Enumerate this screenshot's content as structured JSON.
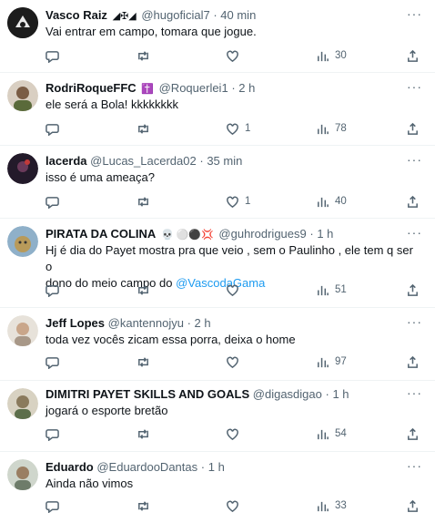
{
  "tweets": [
    {
      "name": "Vasco Raiz",
      "badges": "◢✠◢",
      "handle": "@hugoficial7",
      "time": "40 min",
      "lines": [
        "Vai entrar em campo, tomara que jogue."
      ],
      "likes": "",
      "views": "30",
      "avatar_color": "#1c1c1c"
    },
    {
      "name": "RodriRoqueFFC",
      "badges": "✝️",
      "handle": "@Roquerlei1",
      "time": "2 h",
      "lines": [
        "ele será a Bola! kkkkkkkk"
      ],
      "likes": "1",
      "views": "78",
      "avatar_color": "#7a5c44"
    },
    {
      "name": "lacerda",
      "badges": "",
      "handle": "@Lucas_Lacerda02",
      "time": "35 min",
      "lines": [
        "isso é uma ameaça?"
      ],
      "likes": "1",
      "views": "40",
      "avatar_color": "#2a2030"
    },
    {
      "name": "PIRATA DA COLINA",
      "badges": "💀 ⚪⚫💢",
      "handle": "@guhrodrigues9",
      "time": "1 h",
      "lines": [
        "Hj é dia do Payet mostra pra que veio , sem o Paulinho , ele tem q ser o",
        "dono do meio campo do "
      ],
      "link": "@VascodaGama",
      "likes": "",
      "views": "51",
      "avatar_color": "#b89a5a"
    },
    {
      "name": "Jeff Lopes",
      "badges": "",
      "handle": "@kantennojyu",
      "time": "2 h",
      "lines": [
        "toda vez vocês zicam essa porra, deixa o home"
      ],
      "likes": "",
      "views": "97",
      "avatar_color": "#c9b8a6"
    },
    {
      "name": "DIMITRI PAYET SKILLS AND GOALS",
      "badges": "",
      "handle": "@digasdigao",
      "time": "1 h",
      "lines": [
        "jogará o esporte bretão"
      ],
      "likes": "",
      "views": "54",
      "avatar_color": "#8a7a5c"
    },
    {
      "name": "Eduardo",
      "badges": "",
      "handle": "@EduardooDantas",
      "time": "1 h",
      "lines": [
        "Ainda não vimos"
      ],
      "likes": "",
      "views": "33",
      "avatar_color": "#6e7c6a"
    }
  ],
  "sep": "·",
  "more": "···"
}
